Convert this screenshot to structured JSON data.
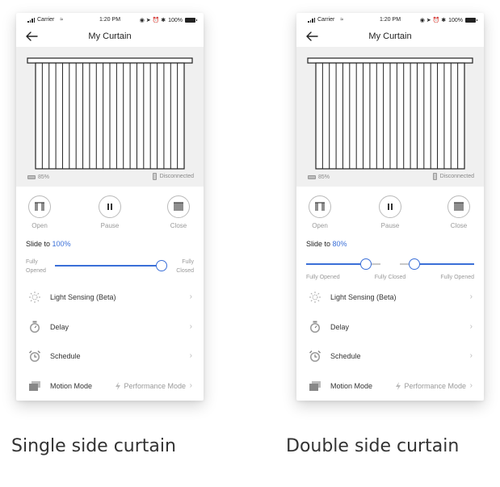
{
  "status_bar": {
    "carrier": "Carrier",
    "time": "1:20 PM",
    "battery": "100%"
  },
  "nav": {
    "title": "My Curtain"
  },
  "device": {
    "battery": "85%",
    "connection": "Disconnected"
  },
  "controls": {
    "open": "Open",
    "pause": "Pause",
    "close": "Close"
  },
  "slide": {
    "prefix": "Slide to"
  },
  "single": {
    "slide_value": "100%",
    "position_fraction": 1.0,
    "left_label": "Fully\nOpened",
    "right_label": "Fully\nClosed",
    "left_label_line1": "Fully",
    "left_label_line2": "Opened",
    "right_label_line1": "Fully",
    "right_label_line2": "Closed"
  },
  "double": {
    "slide_value": "80%",
    "position_fraction": 0.8,
    "left_label": "Fully Opened",
    "center_label": "Fully Closed",
    "right_label": "Fully Opened"
  },
  "menu": {
    "light_sensing": "Light Sensing (Beta)",
    "delay": "Delay",
    "schedule": "Schedule",
    "motion_mode": "Motion Mode",
    "motion_mode_value": "Performance Mode"
  },
  "captions": {
    "single": "Single side curtain",
    "double": "Double side curtain"
  },
  "colors": {
    "accent": "#3a6fd8",
    "hero_bg": "#f0f0f0"
  },
  "icons": {
    "back": "arrow-left-icon",
    "open": "curtain-open-icon",
    "pause": "pause-icon",
    "close": "curtain-close-icon",
    "light": "sun-icon",
    "delay": "stopwatch-icon",
    "schedule": "alarm-clock-icon",
    "motion": "layers-icon",
    "performance": "lightning-icon"
  }
}
